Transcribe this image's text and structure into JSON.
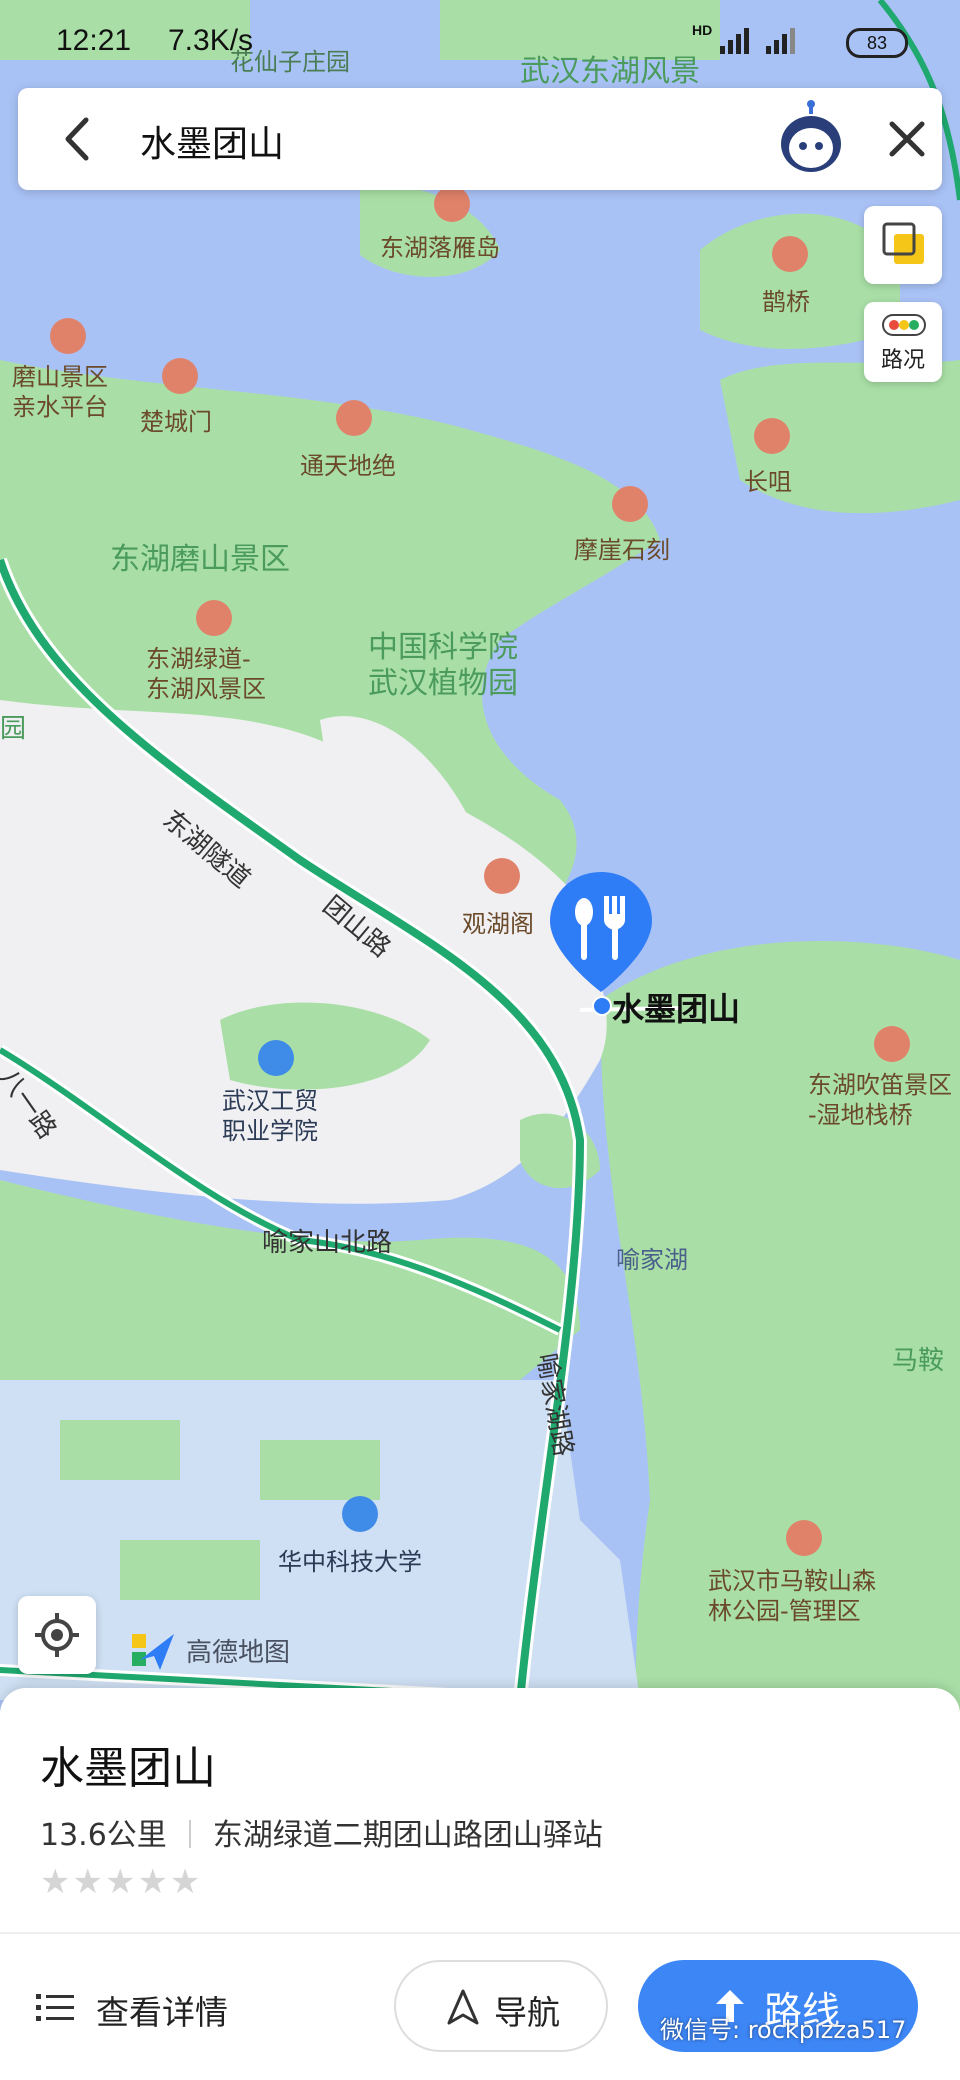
{
  "status_bar": {
    "time": "12:21",
    "speed": "7.3K/s",
    "network": "HD",
    "battery": "83"
  },
  "search": {
    "query": "水墨团山"
  },
  "controls": {
    "traffic_label": "路况"
  },
  "map": {
    "pois": [
      {
        "name": "东湖落雁岛"
      },
      {
        "name": "鹊桥"
      },
      {
        "name": "磨山景区\n亲水平台"
      },
      {
        "name": "楚城门"
      },
      {
        "name": "通天地绝"
      },
      {
        "name": "长咀"
      },
      {
        "name": "摩崖石刻"
      },
      {
        "name": "东湖绿道-\n东湖风景区"
      },
      {
        "name": "观湖阁"
      },
      {
        "name": "东湖吹笛景区\n-湿地栈桥"
      },
      {
        "name": "武汉市马鞍山森\n林公园-管理区"
      }
    ],
    "areas": [
      {
        "name": "花仙子庄园"
      },
      {
        "name": "武汉东湖风景"
      },
      {
        "name": "东湖磨山景区"
      },
      {
        "name": "中国科学院\n武汉植物园"
      },
      {
        "name": "喻家湖"
      },
      {
        "name": "马鞍"
      },
      {
        "name": "园"
      }
    ],
    "schools": [
      {
        "name": "武汉工贸\n职业学院"
      },
      {
        "name": "华中科技大学"
      }
    ],
    "roads": [
      {
        "name": "东湖隧道"
      },
      {
        "name": "团山路"
      },
      {
        "name": "八一路"
      },
      {
        "name": "喻家山北路"
      },
      {
        "name": "喻家湖路"
      }
    ],
    "selected": {
      "name": "水墨团山",
      "icon": "restaurant-icon",
      "color": "#2f7df6"
    },
    "logo": "高德地图"
  },
  "place": {
    "title": "水墨团山",
    "distance": "13.6公里",
    "address": "东湖绿道二期团山路团山驿站",
    "rating_stars": 0,
    "stars_display": "★★★★★"
  },
  "actions": {
    "details": "查看详情",
    "navigate": "导航",
    "route": "路线"
  },
  "watermark": "微信号: rockpizza517",
  "colors": {
    "water": "#a9c2f5",
    "park": "#a9dfa6",
    "land": "#f0f0f2",
    "road": "#1fa96f",
    "accent": "#3d86f6"
  }
}
